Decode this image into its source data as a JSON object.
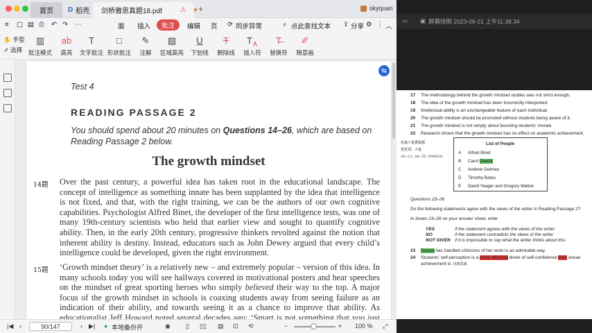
{
  "tabs": {
    "home": "首页",
    "shell": "稻壳",
    "doc": "剑桥雅思真题18.pdf",
    "user": "skyquan"
  },
  "menu": {
    "items": [
      "面",
      "插入",
      "批注",
      "编辑",
      "页"
    ],
    "sync": "同步异常",
    "find": "点此查找文本",
    "share": "分享"
  },
  "toolbar": {
    "hand": "手型",
    "select": "选择",
    "items": [
      "批注模式",
      "高亮",
      "文字批注",
      "形状批注",
      "注解",
      "区域高亮",
      "下划线",
      "删除线",
      "插入符",
      "替换符",
      "随意画"
    ]
  },
  "page": {
    "test": "Test 4",
    "passage": "READING PASSAGE 2",
    "intro_a": "You should spend about 20 minutes on ",
    "intro_b": "Questions 14–26",
    "intro_c": ", which are based on Reading Passage 2 below.",
    "title": "The growth mindset",
    "p1_num": "14题",
    "p1": "Over the past century, a powerful idea has taken root in the educational landscape. The concept of intelligence as something innate has been supplanted by the idea that intelligence is not fixed, and that, with the right training, we can be the authors of our own cognitive capabilities. Psychologist Alfred Binet, the developer of the first intelligence tests, was one of many 19th-century scientists who held that earlier view and sought to quantify cognitive ability. Then, in the early 20th century, progressive thinkers revolted against the notion that inherent ability is destiny. Instead, educators such as John Dewey argued that every child’s intelligence could be developed, given the right environment.",
    "p2_num": "15题",
    "p2_a": "‘Growth mindset theory’ is a relatively new – and extremely popular – version of this idea. In many schools today you will see hallways covered in motivational posters and hear speeches on the mindset of great sporting heroes who simply ",
    "p2_b": "believed",
    "p2_c": " their way to the top. A major focus of the growth mindset in schools is coaxing students away from seeing failure as an indication of their ability, and towards seeing it as a chance to improve that ability. As educationalist Jeff Howard noted several decades ago: ‘Smart is not something that you just are, smart is something"
  },
  "status": {
    "page": "90/147",
    "backup": "本地备份开",
    "zoom": "100 %"
  },
  "right": {
    "title": "屏幕快照 2023-06-21 上午11.38.34",
    "lines": [
      {
        "n": "17",
        "t": "The methodology behind the growth mindset studies was not strict enough."
      },
      {
        "n": "18",
        "t": "The idea of the growth mindset has been incorrectly interpreted."
      },
      {
        "n": "19",
        "t": "Intellectual ability is an unchangeable feature of each individual."
      },
      {
        "n": "20",
        "t": "The growth mindset should be promoted without students being aware of it."
      },
      {
        "n": "21",
        "t": "The growth mindset is not simply about boosting students’ morale."
      },
      {
        "n": "22",
        "t": "Research shows that the growth mindset has no effect on academic achievement."
      }
    ],
    "hw1": "先找人名再看题",
    "hw2": "定位词：人名",
    "hw3": "A0. C2. A6. 5Y. D9R6(M",
    "list_title": "List of People",
    "people": [
      {
        "l": "A",
        "n": "Alfred Binet"
      },
      {
        "l": "B",
        "n": "Carol ",
        "h": "Dweck"
      },
      {
        "l": "C",
        "n": "Andrew Gelman"
      },
      {
        "l": "D",
        "n": "Timothy Bates"
      },
      {
        "l": "E",
        "n": "David Yeager and Gregory Walton"
      }
    ],
    "q": "Questions 23–26",
    "q_intro": "Do the following statements agree with the views of the writer in Reading Passage 2?",
    "q_box": "In boxes 23–26 on your answer sheet, write",
    "yes": "YES",
    "yes_t": "if the statement agrees with the views of the writer",
    "no": "NO",
    "no_t": "if the statement contradicts the views of the writer",
    "ng": "NOT GIVEN",
    "ng_t": "if it is impossible to say what the writer thinks about this",
    "q23_n": "23",
    "q23_h": "Dweck",
    "q23_t": " has handled criticisms of her work in an admirable way.",
    "q24_n": "24",
    "q24_a": "Students’ self-perception is a ",
    "q24_h1": "more effective",
    "q24_b": " driver of self-confidence ",
    "q24_h2": "than",
    "q24_c": " actual",
    "q24_d": "achievement is.",
    "q24_hw": "比较关系"
  }
}
